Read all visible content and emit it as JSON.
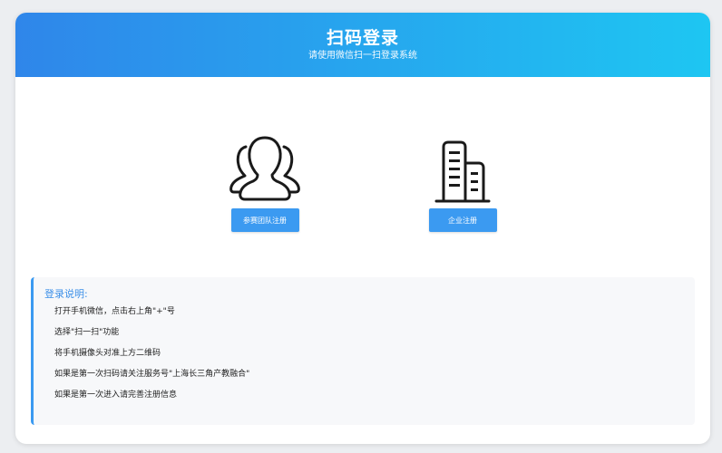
{
  "header": {
    "title": "扫码登录",
    "subtitle": "请使用微信扫一扫登录系统"
  },
  "options": [
    {
      "icon": "users-icon",
      "label": "参赛团队注册"
    },
    {
      "icon": "building-icon",
      "label": "企业注册"
    }
  ],
  "instructions": {
    "title": "登录说明:",
    "steps": [
      "打开手机微信，点击右上角\"+\"号",
      "选择\"扫一扫\"功能",
      "将手机摄像头对准上方二维码",
      "如果是第一次扫码请关注服务号\"上海长三角产教融合\"",
      "如果是第一次进入请完善注册信息"
    ]
  },
  "colors": {
    "header_gradient_start": "#2f86ea",
    "header_gradient_end": "#1ec6f2",
    "accent": "#3b9af1"
  }
}
